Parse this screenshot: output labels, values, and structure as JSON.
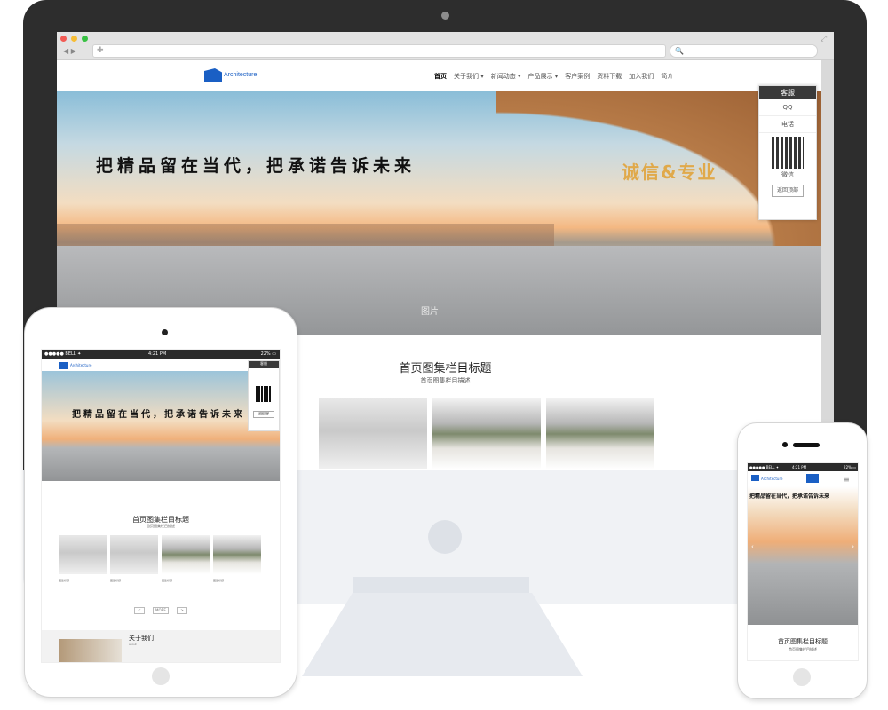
{
  "browser": {
    "nav_arrows": "◀ ▶",
    "url_icon": "✚",
    "search_icon": "🔍",
    "expand_icon": "⤢"
  },
  "site": {
    "logo_text": "Architecture",
    "nav": [
      "首页",
      "关于我们 ▾",
      "新闻动态 ▾",
      "产品展示 ▾",
      "客户案例",
      "资料下载",
      "加入我们",
      "简介"
    ],
    "banner_title": "把精品留在当代，把承诺告诉未来",
    "banner_slogan": "诚信&专业",
    "banner_caption": "图片",
    "gallery_title": "首页图集栏目标题",
    "gallery_subtitle": "首页图集栏目描述",
    "gallery_item_label": "图集标题",
    "pager": [
      "<",
      "MORE",
      ">"
    ],
    "about_title": "关于我们",
    "about_sub": "about"
  },
  "service": {
    "title": "客服",
    "qq": "QQ",
    "phone": "电话",
    "wechat": "微信",
    "back_top": "返回顶部"
  },
  "tablet_status": {
    "left": "●●●●● BELL ✦",
    "time": "4:21 PM",
    "right": "22% ▭"
  },
  "phone_status": {
    "left": "●●●●● BELL ✦",
    "time": "4:21 PM",
    "right": "22% ▭"
  },
  "colors": {
    "brand": "#1a5fc4",
    "slogan": "#e0a94a",
    "monitor": "#2d2d2d"
  }
}
